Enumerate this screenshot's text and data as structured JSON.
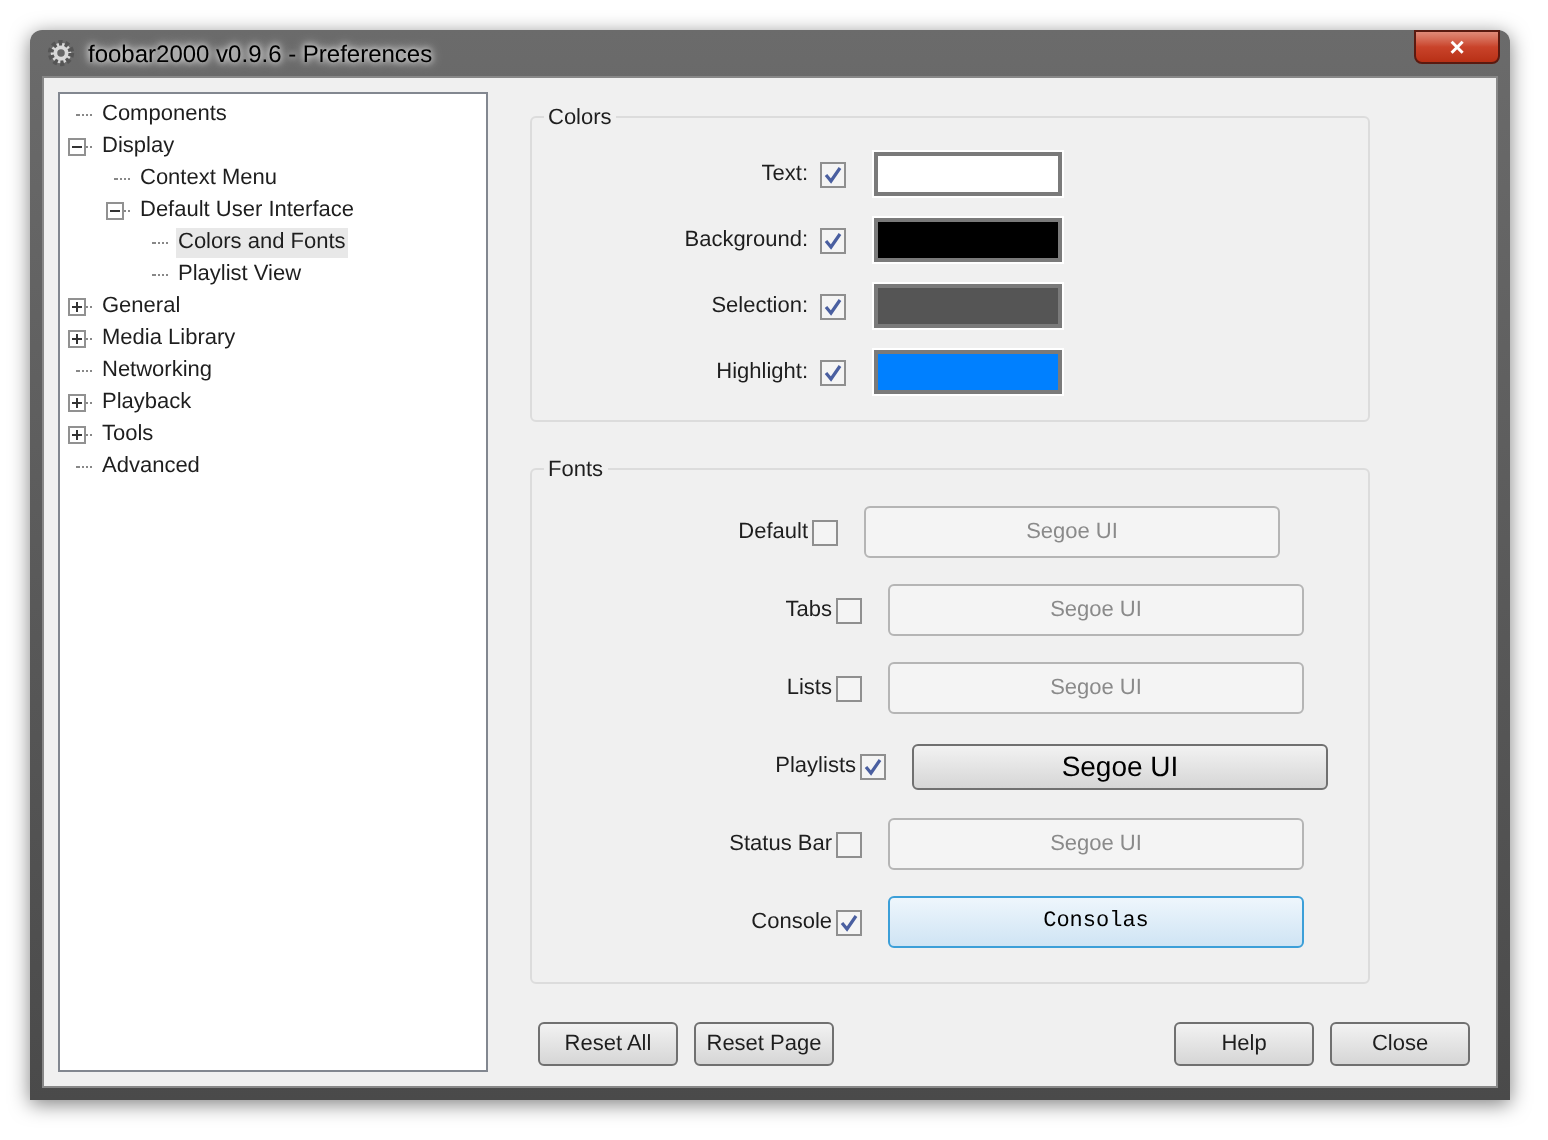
{
  "window": {
    "title": "foobar2000 v0.9.6 - Preferences",
    "close_button": "×"
  },
  "tree": [
    {
      "label": "Components",
      "selected": false
    },
    {
      "label": "Display",
      "selected": false,
      "expanded": true,
      "children": [
        {
          "label": "Context Menu",
          "selected": false
        },
        {
          "label": "Default User Interface",
          "selected": false,
          "expanded": true,
          "children": [
            {
              "label": "Colors and Fonts",
              "selected": true
            },
            {
              "label": "Playlist View",
              "selected": false
            }
          ]
        }
      ]
    },
    {
      "label": "General",
      "selected": false,
      "expanded": false
    },
    {
      "label": "Media Library",
      "selected": false,
      "expanded": false
    },
    {
      "label": "Networking",
      "selected": false
    },
    {
      "label": "Playback",
      "selected": false,
      "expanded": false
    },
    {
      "label": "Tools",
      "selected": false,
      "expanded": false
    },
    {
      "label": "Advanced",
      "selected": false
    }
  ],
  "colors": {
    "title": "Colors",
    "items": [
      {
        "label": "Text:",
        "checked": true,
        "color": "#ffffff"
      },
      {
        "label": "Background:",
        "checked": true,
        "color": "#000000"
      },
      {
        "label": "Selection:",
        "checked": true,
        "color": "#555555"
      },
      {
        "label": "Highlight:",
        "checked": true,
        "color": "#0080ff"
      }
    ]
  },
  "fonts": {
    "title": "Fonts",
    "items": [
      {
        "label": "Default",
        "checked": false,
        "font": "Segoe UI",
        "kind": "plain",
        "focused": false
      },
      {
        "label": "Tabs",
        "checked": false,
        "font": "Segoe UI",
        "kind": "plain",
        "focused": false
      },
      {
        "label": "Lists",
        "checked": false,
        "font": "Segoe UI",
        "kind": "plain",
        "focused": false
      },
      {
        "label": "Playlists",
        "checked": true,
        "font": "Segoe UI",
        "kind": "large",
        "focused": false
      },
      {
        "label": "Status Bar",
        "checked": false,
        "font": "Segoe UI",
        "kind": "plain",
        "focused": false
      },
      {
        "label": "Console",
        "checked": true,
        "font": "Consolas",
        "kind": "mono",
        "focused": true
      }
    ]
  },
  "buttons_left": [
    "Reset All",
    "Reset Page"
  ],
  "buttons_right": [
    "Help",
    "Close"
  ]
}
